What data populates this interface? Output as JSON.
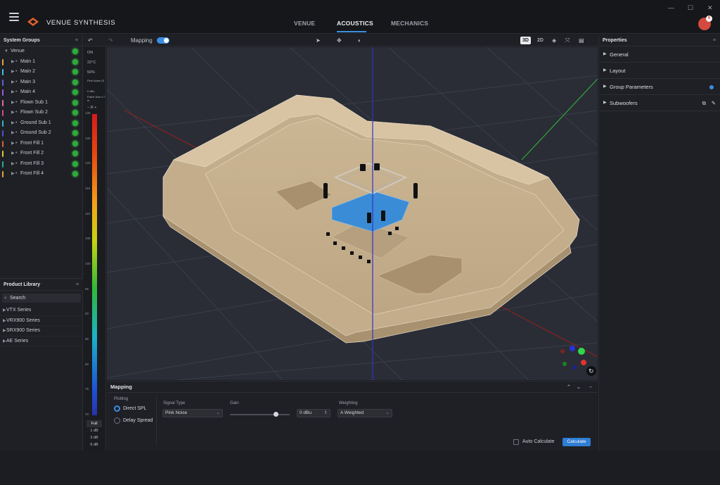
{
  "app": {
    "brand": "VENUE SYNTHESIS",
    "nav": [
      "VENUE",
      "ACOUSTICS",
      "MECHANICS"
    ],
    "active_nav": "ACOUSTICS",
    "avatar_badge": "6"
  },
  "window_controls": [
    "—",
    "☐",
    "✕"
  ],
  "system_groups": {
    "title": "System Groups",
    "root": "Venue",
    "items": [
      {
        "label": "Main 1",
        "color": "#e9a43d"
      },
      {
        "label": "Main 2",
        "color": "#3fc1e8"
      },
      {
        "label": "Main 3",
        "color": "#5b62d8"
      },
      {
        "label": "Main 4",
        "color": "#a15ad8"
      },
      {
        "label": "Flown Sub 1",
        "color": "#e26aa8"
      },
      {
        "label": "Flown Sub 2",
        "color": "#d64a8c"
      },
      {
        "label": "Ground Sub 1",
        "color": "#2fb9c9"
      },
      {
        "label": "Ground Sub 2",
        "color": "#4e52d0"
      },
      {
        "label": "Front Fill 1",
        "color": "#d9632f"
      },
      {
        "label": "Front Fill 2",
        "color": "#e3c23a"
      },
      {
        "label": "Front Fill 3",
        "color": "#2aa79a"
      },
      {
        "label": "Front Fill 4",
        "color": "#e8a23b"
      }
    ]
  },
  "product_library": {
    "title": "Product Library",
    "search_placeholder": "Search",
    "items": [
      "VTX Series",
      "VRX900 Series",
      "SRX900 Series",
      "AE Series"
    ]
  },
  "scale_panel": {
    "on": "ON",
    "temp": "22°C",
    "humidity": "50%",
    "signal": "Pink Noise (S",
    "db_label": "0 dBu",
    "patch": "Patch Size 0.7 m",
    "ticks": [
      "130",
      "125",
      "120",
      "115",
      "110",
      "105",
      "100",
      "95",
      "90",
      "85",
      "80",
      "75",
      "70"
    ],
    "range_buttons": [
      "Full",
      "1 dB",
      "3 dB",
      "6 dB"
    ]
  },
  "toolbar": {
    "mapping_label": "Mapping",
    "mapping_on": true,
    "view_3d": "3D",
    "view_2d": "2D"
  },
  "properties": {
    "title": "Properties",
    "sections": [
      "General",
      "Layout",
      "Group Parameters",
      "Subwoofers"
    ]
  },
  "mapping": {
    "title": "Mapping",
    "plotting_label": "Plotting",
    "plot_options": [
      "Direct SPL",
      "Delay Spread"
    ],
    "selected_plot": "Direct SPL",
    "signal_type_label": "Signal Type",
    "signal_type": "Pink Noise",
    "gain_label": "Gain",
    "gain_value": "0 dBu",
    "weighting_label": "Weighting",
    "weighting": "A Weighted",
    "auto_calc": "Auto Calculate",
    "calc_button": "Calculate"
  }
}
